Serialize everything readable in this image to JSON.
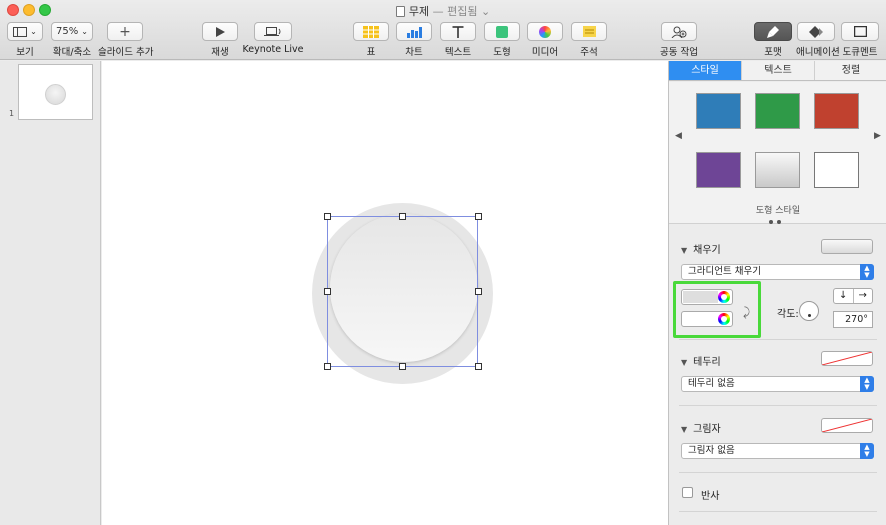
{
  "window": {
    "title": "무제",
    "separator": "—",
    "state": "편집됨"
  },
  "toolbar": {
    "view": {
      "label": "보기"
    },
    "zoom": {
      "value": "75%",
      "label": "확대/축소"
    },
    "add_slide": {
      "label": "슬라이드 추가"
    },
    "play": {
      "label": "재생"
    },
    "keynote_live": {
      "label": "Keynote Live"
    },
    "table": {
      "label": "표"
    },
    "chart": {
      "label": "차트"
    },
    "text": {
      "label": "텍스트"
    },
    "shape": {
      "label": "도형"
    },
    "media": {
      "label": "미디어"
    },
    "comment": {
      "label": "주석"
    },
    "collaborate": {
      "label": "공동 작업"
    },
    "format": {
      "label": "포맷"
    },
    "animate": {
      "label": "애니메이션"
    },
    "document": {
      "label": "도큐멘트"
    }
  },
  "navigator": {
    "slides": [
      {
        "number": "1"
      }
    ]
  },
  "inspector": {
    "tabs": [
      {
        "label": "스타일",
        "active": true
      },
      {
        "label": "텍스트",
        "active": false
      },
      {
        "label": "정렬",
        "active": false
      }
    ],
    "shape_styles": {
      "caption": "도형 스타일",
      "swatches": [
        {
          "name": "blue",
          "color": "#2f7db8"
        },
        {
          "name": "green",
          "color": "#2f9a48"
        },
        {
          "name": "red",
          "color": "#c0412f"
        },
        {
          "name": "purple",
          "color": "#6e4596"
        },
        {
          "name": "gray-gradient",
          "color": "#d8d8d8"
        },
        {
          "name": "white-outline",
          "color": "#ffffff"
        }
      ]
    },
    "fill": {
      "heading": "채우기",
      "type": "그라디언트 채우기",
      "start_color": "#dedede",
      "end_color": "#ffffff",
      "angle_label": "각도:",
      "angle_value": "270°"
    },
    "border": {
      "heading": "테두리",
      "value": "테두리 없음"
    },
    "shadow": {
      "heading": "그림자",
      "value": "그림자 없음"
    },
    "reflection": {
      "label": "반사",
      "checked": false
    }
  }
}
